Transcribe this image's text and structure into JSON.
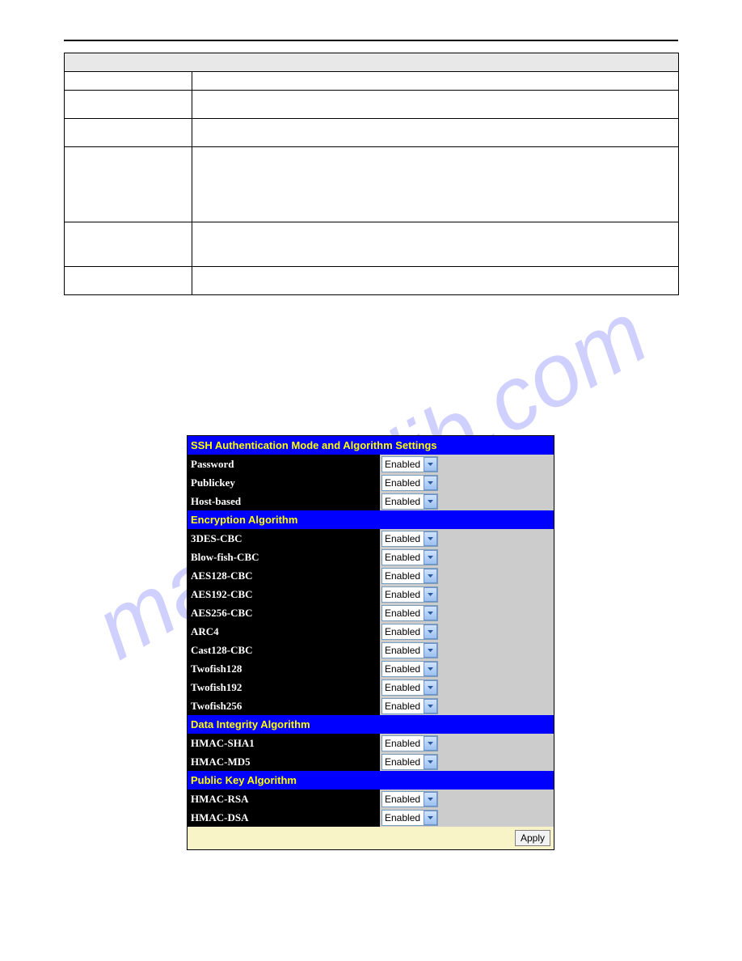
{
  "watermark": "manualslib.com",
  "ssh": {
    "title_main": "SSH Authentication Mode and Algorithm Settings",
    "auth_rows": [
      {
        "label": "Password",
        "value": "Enabled"
      },
      {
        "label": "Publickey",
        "value": "Enabled"
      },
      {
        "label": "Host-based",
        "value": "Enabled"
      }
    ],
    "title_encryption": "Encryption Algorithm",
    "encryption_rows": [
      {
        "label": "3DES-CBC",
        "value": "Enabled"
      },
      {
        "label": "Blow-fish-CBC",
        "value": "Enabled"
      },
      {
        "label": "AES128-CBC",
        "value": "Enabled"
      },
      {
        "label": "AES192-CBC",
        "value": "Enabled"
      },
      {
        "label": "AES256-CBC",
        "value": "Enabled"
      },
      {
        "label": "ARC4",
        "value": "Enabled"
      },
      {
        "label": "Cast128-CBC",
        "value": "Enabled"
      },
      {
        "label": "Twofish128",
        "value": "Enabled"
      },
      {
        "label": "Twofish192",
        "value": "Enabled"
      },
      {
        "label": "Twofish256",
        "value": "Enabled"
      }
    ],
    "title_integrity": "Data Integrity Algorithm",
    "integrity_rows": [
      {
        "label": "HMAC-SHA1",
        "value": "Enabled"
      },
      {
        "label": "HMAC-MD5",
        "value": "Enabled"
      }
    ],
    "title_publickey": "Public Key Algorithm",
    "publickey_rows": [
      {
        "label": "HMAC-RSA",
        "value": "Enabled"
      },
      {
        "label": "HMAC-DSA",
        "value": "Enabled"
      }
    ],
    "apply_label": "Apply"
  }
}
